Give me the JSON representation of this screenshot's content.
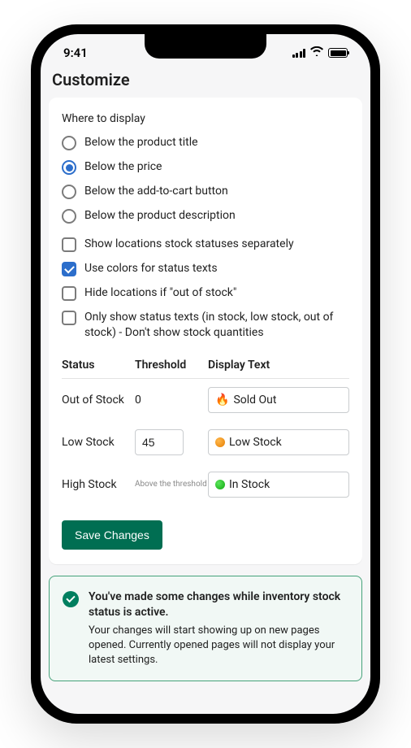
{
  "statusBar": {
    "time": "9:41"
  },
  "pageTitle": "Customize",
  "whereToDisplay": {
    "label": "Where to display",
    "options": [
      {
        "label": "Below the product title",
        "checked": false
      },
      {
        "label": "Below the price",
        "checked": true
      },
      {
        "label": "Below the add-to-cart button",
        "checked": false
      },
      {
        "label": "Below the product description",
        "checked": false
      }
    ]
  },
  "checkboxes": [
    {
      "label": "Show locations stock statuses separately",
      "checked": false
    },
    {
      "label": "Use colors for status texts",
      "checked": true
    },
    {
      "label": "Hide locations if \"out of stock\"",
      "checked": false
    },
    {
      "label": "Only show status texts (in stock, low stock, out of stock) - Don't show stock quantities",
      "checked": false
    }
  ],
  "table": {
    "headers": {
      "status": "Status",
      "threshold": "Threshold",
      "display": "Display Text"
    },
    "rows": [
      {
        "status": "Out of Stock",
        "threshold_text": "0",
        "display_text": "Sold Out",
        "icon": "fire"
      },
      {
        "status": "Low Stock",
        "threshold_value": "45",
        "display_text": "Low Stock",
        "icon": "orange-dot"
      },
      {
        "status": "High Stock",
        "threshold_text": "Above the threshold",
        "display_text": "In Stock",
        "icon": "green-dot"
      }
    ]
  },
  "saveButton": "Save Changes",
  "banner": {
    "title": "You've made some changes while inventory stock status is active.",
    "body": "Your changes will start showing up on new pages opened. Currently opened pages will not display your latest settings."
  }
}
